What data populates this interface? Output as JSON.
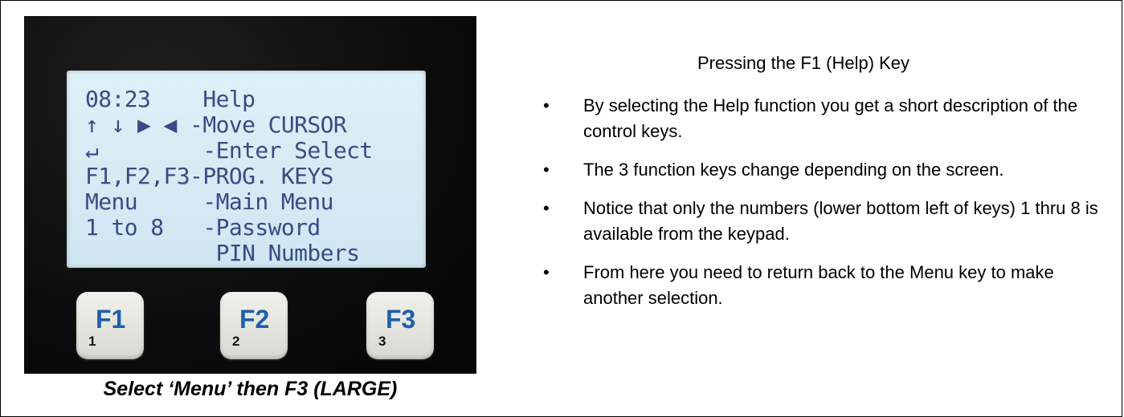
{
  "lcd": {
    "lines": [
      "08:23    Help",
      "↑ ↓ ▶ ◀ -Move CURSOR",
      "↵        -Enter Select",
      "F1,F2,F3-PROG. KEYS",
      "Menu     -Main Menu",
      "1 to 8   -Password",
      "          PIN Numbers"
    ]
  },
  "keys": [
    {
      "label": "F1",
      "num": "1"
    },
    {
      "label": "F2",
      "num": "2"
    },
    {
      "label": "F3",
      "num": "3"
    }
  ],
  "caption": "Select ‘Menu’ then F3 (LARGE)",
  "heading": "Pressing the F1 (Help) Key",
  "bullets": [
    "By selecting the Help function you get a short description of the control keys.",
    "The 3 function keys change depending on the screen.",
    "Notice that only the numbers (lower bottom left of keys) 1 thru 8 is available from the keypad.",
    "From here you need to return back to the Menu key to make another selection."
  ],
  "bullet_symbol": "•",
  "colors": {
    "lcd_text": "#3a4a86",
    "key_label": "#1d5fae",
    "lcd_bg": "#d8ecf6"
  }
}
